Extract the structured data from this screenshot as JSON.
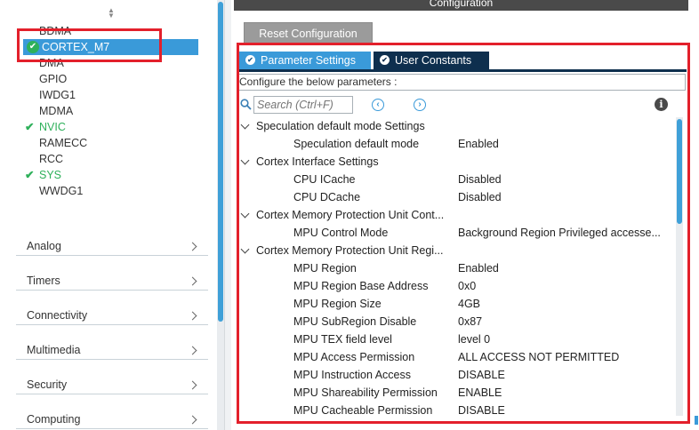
{
  "peripherals": {
    "items": [
      {
        "label": "BDMA",
        "status": "none"
      },
      {
        "label": "CORTEX_M7",
        "status": "selected"
      },
      {
        "label": "DMA",
        "status": "none"
      },
      {
        "label": "GPIO",
        "status": "none"
      },
      {
        "label": "IWDG1",
        "status": "none"
      },
      {
        "label": "MDMA",
        "status": "none"
      },
      {
        "label": "NVIC",
        "status": "ok"
      },
      {
        "label": "RAMECC",
        "status": "none"
      },
      {
        "label": "RCC",
        "status": "none"
      },
      {
        "label": "SYS",
        "status": "ok"
      },
      {
        "label": "WWDG1",
        "status": "none"
      }
    ]
  },
  "categories": [
    "Analog",
    "Timers",
    "Connectivity",
    "Multimedia",
    "Security",
    "Computing"
  ],
  "config": {
    "header": "Configuration",
    "reset_label": "Reset Configuration",
    "tabs": [
      "Parameter Settings",
      "User Constants"
    ],
    "description": "Configure the below parameters :",
    "search_placeholder": "Search (Ctrl+F)",
    "info_glyph": "i"
  },
  "tree": [
    {
      "type": "group",
      "label": "Speculation default mode Settings"
    },
    {
      "type": "param",
      "label": "Speculation default mode",
      "value": "Enabled"
    },
    {
      "type": "group",
      "label": "Cortex Interface Settings"
    },
    {
      "type": "param",
      "label": "CPU ICache",
      "value": "Disabled"
    },
    {
      "type": "param",
      "label": "CPU DCache",
      "value": "Disabled"
    },
    {
      "type": "group",
      "label": "Cortex Memory Protection Unit Cont..."
    },
    {
      "type": "param",
      "label": "MPU Control Mode",
      "value": "Background Region Privileged accesse..."
    },
    {
      "type": "group",
      "label": "Cortex Memory Protection Unit Regi..."
    },
    {
      "type": "param",
      "label": "MPU Region",
      "value": "Enabled"
    },
    {
      "type": "param",
      "label": "MPU Region Base Address",
      "value": "0x0"
    },
    {
      "type": "param",
      "label": "MPU Region Size",
      "value": "4GB"
    },
    {
      "type": "param",
      "label": "MPU SubRegion Disable",
      "value": "0x87"
    },
    {
      "type": "param",
      "label": "MPU TEX field level",
      "value": "level 0"
    },
    {
      "type": "param",
      "label": "MPU Access Permission",
      "value": "ALL ACCESS NOT PERMITTED"
    },
    {
      "type": "param",
      "label": "MPU Instruction Access",
      "value": "DISABLE"
    },
    {
      "type": "param",
      "label": "MPU Shareability Permission",
      "value": "ENABLE"
    },
    {
      "type": "param",
      "label": "MPU Cacheable Permission",
      "value": "DISABLE"
    }
  ],
  "colors": {
    "accent": "#3a9ad9",
    "dark_tab": "#0e2f4e",
    "ok_green": "#2eb05a",
    "highlight_red": "#e3202b"
  }
}
